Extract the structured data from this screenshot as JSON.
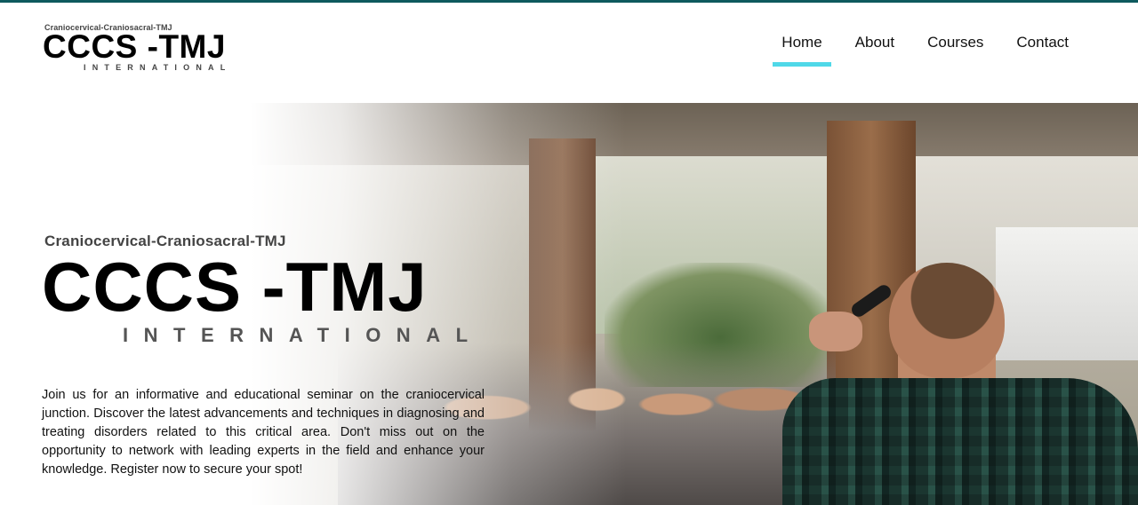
{
  "brand": {
    "top_line": "Craniocervical-Craniosacral-TMJ",
    "name": "CCCS -TMJ",
    "tagline": "INTERNATIONAL"
  },
  "nav": {
    "items": [
      {
        "label": "Home",
        "active": true
      },
      {
        "label": "About",
        "active": false
      },
      {
        "label": "Courses",
        "active": false
      },
      {
        "label": "Contact",
        "active": false
      }
    ]
  },
  "hero": {
    "subtitle": "Craniocervical-Craniosacral-TMJ",
    "title": "CCCS -TMJ",
    "tagline": "INTERNATIONAL",
    "description": "Join us for an informative and educational seminar on the craniocervical junction. Discover the latest advancements and techniques in diagnosing and treating disorders related to this critical area. Don't miss out on the opportunity to network with leading experts in the field and enhance your knowledge. Register now to secure your spot!",
    "image": "speaker-presenting-to-audience-photo"
  },
  "colors": {
    "top_bar": "#0e5a5e",
    "nav_active_underline": "#4fd8e8"
  }
}
